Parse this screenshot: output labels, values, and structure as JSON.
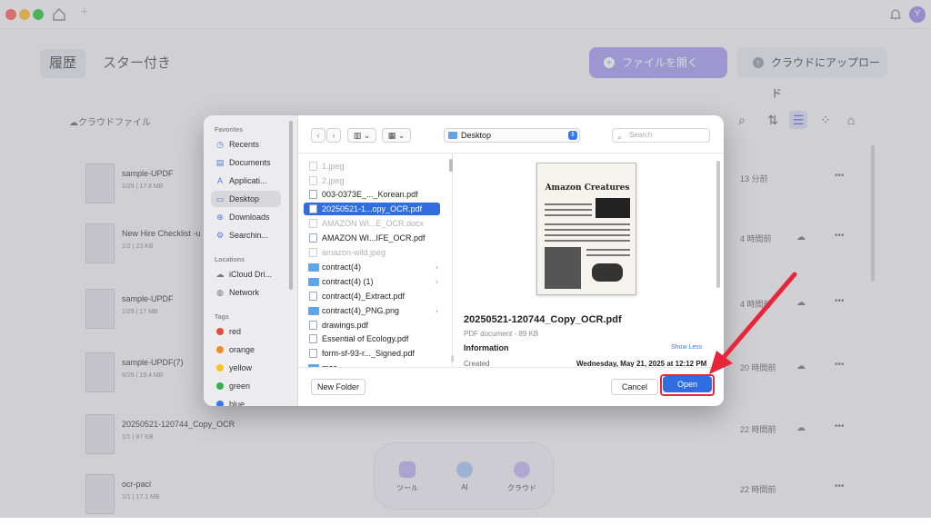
{
  "app": {
    "avatar_letter": "Y",
    "tabs": [
      {
        "label": "履歴"
      },
      {
        "label": "スター付き"
      }
    ],
    "open_file_button": "ファイルを開く",
    "upload_cloud_button": "クラウドにアップロード",
    "cloud_files_label": "クラウドファイル"
  },
  "files": [
    {
      "name": "sample-UPDF",
      "meta": "1/29 | 17.8 MB",
      "time": "13 分前"
    },
    {
      "name": "New Hire Checklist -u",
      "meta": "1/2 | 23 KB",
      "time": "4 時間前"
    },
    {
      "name": "sample-UPDF",
      "meta": "1/29 | 17 MB",
      "time": "4 時間前"
    },
    {
      "name": "sample-UPDF(7)",
      "meta": "8/29 | 19.4 MB",
      "time": "20 時間前"
    },
    {
      "name": "20250521-120744_Copy_OCR",
      "meta": "1/1 | 87 KB",
      "time": "22 時間前"
    },
    {
      "name": "ocr-paci",
      "meta": "1/1 | 17.1 MB",
      "time": "22 時間前"
    }
  ],
  "dock": [
    {
      "label": "ツール"
    },
    {
      "label": "AI"
    },
    {
      "label": "クラウド"
    }
  ],
  "dialog": {
    "sidebar": {
      "favorites_header": "Favorites",
      "favorites": [
        {
          "label": "Recents",
          "icon": "clock-icon"
        },
        {
          "label": "Documents",
          "icon": "document-icon"
        },
        {
          "label": "Applicati...",
          "icon": "applications-icon"
        },
        {
          "label": "Desktop",
          "icon": "desktop-icon"
        },
        {
          "label": "Downloads",
          "icon": "downloads-icon"
        },
        {
          "label": "Searchin...",
          "icon": "gear-icon"
        }
      ],
      "locations_header": "Locations",
      "locations": [
        {
          "label": "iCloud Dri...",
          "icon": "cloud-icon"
        },
        {
          "label": "Network",
          "icon": "globe-icon"
        }
      ],
      "tags_header": "Tags",
      "tags": [
        {
          "label": "red",
          "color": "#e84a3c"
        },
        {
          "label": "orange",
          "color": "#f08a24"
        },
        {
          "label": "yellow",
          "color": "#f5c723"
        },
        {
          "label": "green",
          "color": "#34b24a"
        },
        {
          "label": "blue",
          "color": "#3478f6"
        }
      ]
    },
    "location": "Desktop",
    "search_placeholder": "Search",
    "file_list": [
      {
        "name": "1.jpeg",
        "kind": "image",
        "dim": true
      },
      {
        "name": "2.jpeg",
        "kind": "image",
        "dim": true
      },
      {
        "name": "003-0373E_..._Korean.pdf",
        "kind": "pdf"
      },
      {
        "name": "20250521-1...opy_OCR.pdf",
        "kind": "pdf",
        "selected": true
      },
      {
        "name": "AMAZON WI...E_OCR.docx",
        "kind": "doc",
        "dim": true
      },
      {
        "name": "AMAZON WI...IFE_OCR.pdf",
        "kind": "pdf"
      },
      {
        "name": "amazon-wild.jpeg",
        "kind": "image",
        "dim": true
      },
      {
        "name": "contract(4)",
        "kind": "folder"
      },
      {
        "name": "contract(4) (1)",
        "kind": "folder"
      },
      {
        "name": "contract(4)_Extract.pdf",
        "kind": "pdf"
      },
      {
        "name": "contract(4)_PNG.png",
        "kind": "folder"
      },
      {
        "name": "drawings.pdf",
        "kind": "pdf"
      },
      {
        "name": "Essential of Ecology.pdf",
        "kind": "pdf"
      },
      {
        "name": "form-sf-93-r..._Signed.pdf",
        "kind": "pdf"
      },
      {
        "name": "mac",
        "kind": "folder"
      }
    ],
    "preview": {
      "doc_heading": "Amazon Creatures",
      "filename": "20250521-120744_Copy_OCR.pdf",
      "type": "PDF document - 89 KB",
      "info_header": "Information",
      "show_less": "Show Less",
      "created_label": "Created",
      "created_value": "Wednesday, May 21, 2025 at 12:12 PM"
    },
    "new_folder": "New Folder",
    "cancel": "Cancel",
    "open": "Open"
  },
  "colors": {
    "accent": "#2f6de1",
    "highlight": "#e8263a",
    "brand": "#a69cf2"
  }
}
